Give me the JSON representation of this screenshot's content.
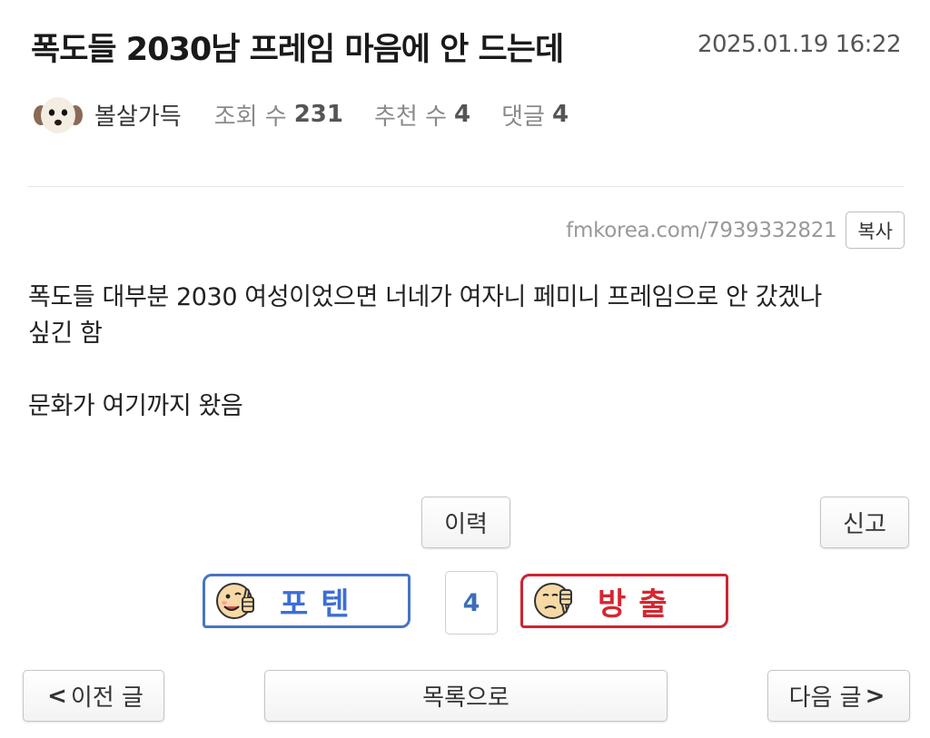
{
  "post": {
    "title": "폭도들 2030남 프레임 마음에 안 드는데",
    "timestamp": "2025.01.19 16:22",
    "author": "볼살가득",
    "views_label": "조회 수",
    "views": "231",
    "recommend_label": "추천 수",
    "recommend": "4",
    "comments_label": "댓글",
    "comments": "4",
    "short_url": "fmkorea.com/7939332821",
    "copy_label": "복사",
    "body": [
      "폭도들 대부분 2030 여성이었으면 너네가 여자니 페미니 프레임으로 안 갔겠나",
      "싶긴 함",
      "문화가 여기까지 왔음"
    ]
  },
  "actions": {
    "history_label": "이력",
    "report_label": "신고"
  },
  "vote": {
    "up_label": "포텐",
    "count": "4",
    "down_label": "방출",
    "up_color": "#3d6ed6",
    "down_color": "#d6262f"
  },
  "nav": {
    "prev_label": "이전 글",
    "list_label": "목록으로",
    "next_label": "다음 글",
    "prev_icon": "chevron-left-icon",
    "next_icon": "chevron-right-icon"
  }
}
